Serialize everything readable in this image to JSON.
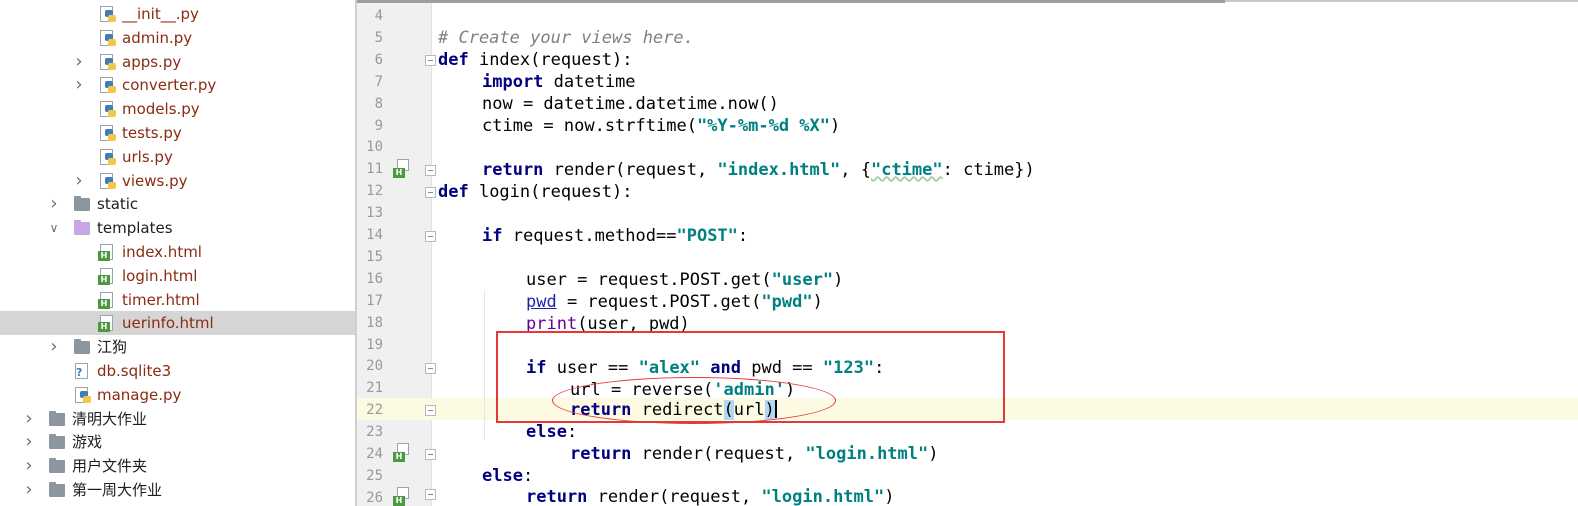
{
  "project_tree": {
    "items": [
      {
        "name": "__init__.py",
        "kind": "py",
        "level": 3,
        "expander": false
      },
      {
        "name": "admin.py",
        "kind": "py",
        "level": 3,
        "expander": false
      },
      {
        "name": "apps.py",
        "kind": "py",
        "level": 3,
        "expander": true
      },
      {
        "name": "converter.py",
        "kind": "py",
        "level": 3,
        "expander": true
      },
      {
        "name": "models.py",
        "kind": "py",
        "level": 3,
        "expander": false
      },
      {
        "name": "tests.py",
        "kind": "py",
        "level": 3,
        "expander": false
      },
      {
        "name": "urls.py",
        "kind": "py",
        "level": 3,
        "expander": false
      },
      {
        "name": "views.py",
        "kind": "py",
        "level": 3,
        "expander": true
      },
      {
        "name": "static",
        "kind": "folder",
        "level": 2,
        "expander": true
      },
      {
        "name": "templates",
        "kind": "folder-templates",
        "level": 2,
        "expander": true,
        "expanded": true
      },
      {
        "name": "index.html",
        "kind": "html",
        "level": 3,
        "expander": false
      },
      {
        "name": "login.html",
        "kind": "html",
        "level": 3,
        "expander": false
      },
      {
        "name": "timer.html",
        "kind": "html",
        "level": 3,
        "expander": false
      },
      {
        "name": "uerinfo.html",
        "kind": "html",
        "level": 3,
        "expander": false,
        "selected": true
      },
      {
        "name": "江狗",
        "kind": "folder",
        "level": 2,
        "expander": true
      },
      {
        "name": "db.sqlite3",
        "kind": "db",
        "level": 2,
        "expander": false
      },
      {
        "name": "manage.py",
        "kind": "py",
        "level": 2,
        "expander": false
      },
      {
        "name": "清明大作业",
        "kind": "folder",
        "level": 1,
        "expander": true
      },
      {
        "name": "游戏",
        "kind": "folder",
        "level": 1,
        "expander": true
      },
      {
        "name": "用户文件夹",
        "kind": "folder",
        "level": 1,
        "expander": true
      },
      {
        "name": "第一周大作业",
        "kind": "folder",
        "level": 1,
        "expander": true
      }
    ]
  },
  "editor": {
    "line_numbers": [
      "4",
      "5",
      "6",
      "7",
      "8",
      "9",
      "10",
      "11",
      "12",
      "13",
      "14",
      "15",
      "16",
      "17",
      "18",
      "19",
      "20",
      "21",
      "22",
      "23",
      "24",
      "25",
      "26"
    ],
    "lines": {
      "l5": {
        "comment": "# Create your views here."
      },
      "l6": {
        "kw": "def",
        "rest": " index(request):"
      },
      "l7": {
        "kw": "import",
        "rest": " datetime"
      },
      "l8": {
        "text": "now = datetime.datetime.now()"
      },
      "l9": {
        "pre": "ctime = now.strftime(",
        "str": "\"%Y-%m-%d %X\"",
        "post": ")"
      },
      "l11": {
        "kw": "return",
        "pre": " render(request, ",
        "str1": "\"index.html\"",
        "mid": ", {",
        "str2": "\"ctime\"",
        "post": ": ctime})"
      },
      "l12": {
        "kw": "def",
        "rest": " login(request):"
      },
      "l14": {
        "kw": "if",
        "pre": " request.method==",
        "str": "\"POST\"",
        "post": ":"
      },
      "l16": {
        "pre": "user = request.POST.get(",
        "str": "\"user\"",
        "post": ")"
      },
      "l17": {
        "var": "pwd",
        "pre": " = request.POST.get(",
        "str": "\"pwd\"",
        "post": ")"
      },
      "l18": {
        "fn": "print",
        "post": "(user, pwd)"
      },
      "l20": {
        "kw": "if",
        "a": " user == ",
        "s1": "\"alex\"",
        "kw2": " and",
        "b": " pwd == ",
        "s2": "\"123\"",
        "post": ":"
      },
      "l21": {
        "pre": "url = reverse(",
        "str": "'admin'",
        "post": ")"
      },
      "l22": {
        "kw": "return",
        "pre": " redirect",
        "p1": "(",
        "arg": "url",
        "p2": ")"
      },
      "l23": {
        "kw": "else",
        "post": ":"
      },
      "l24": {
        "kw": "return",
        "pre": " render(request, ",
        "str": "\"login.html\"",
        "post": ")"
      },
      "l25": {
        "kw": "else",
        "post": ":"
      },
      "l26": {
        "kw": "return",
        "pre": " render(request, ",
        "str": "\"login.html\"",
        "post": ")"
      }
    }
  },
  "colors": {
    "keyword": "#000080",
    "string": "#008080",
    "comment": "#808080",
    "file_label": "#8a2b12",
    "annotation_red": "#e53935",
    "caret_line": "#fcfae2"
  }
}
